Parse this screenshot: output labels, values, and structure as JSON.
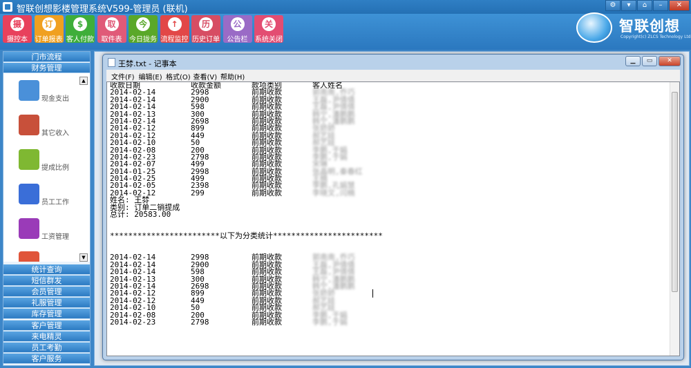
{
  "app": {
    "title": "智联创想影楼管理系统V599-管理员 (联机)",
    "logo_main": "智联创想",
    "logo_sub": "Copyright(c) ZLCS Technology Ltd"
  },
  "toolbar": [
    {
      "label": "摄控本",
      "color": "#e8415c",
      "glyph": "摄"
    },
    {
      "label": "订单报表",
      "color": "#f0a020",
      "glyph": "订"
    },
    {
      "label": "客人付款",
      "color": "#3fae3a",
      "glyph": "$"
    },
    {
      "label": "取件表",
      "color": "#e05a78",
      "glyph": "取"
    },
    {
      "label": "今日拢务",
      "color": "#5aa829",
      "glyph": "今"
    },
    {
      "label": "流程监控",
      "color": "#e24747",
      "glyph": "↑"
    },
    {
      "label": "历史订单",
      "color": "#d74d63",
      "glyph": "历"
    },
    {
      "label": "公告栏",
      "color": "#9a6bc6",
      "glyph": "公"
    },
    {
      "label": "系统关闭",
      "color": "#e34d72",
      "glyph": "关"
    }
  ],
  "sidebar": {
    "top_items": [
      "门市流程",
      "财务管理"
    ],
    "finance_items": [
      {
        "label": "现金支出",
        "color": "#4a90d9",
        "icon": "cash-out-icon"
      },
      {
        "label": "其它收入",
        "color": "#c8503a",
        "icon": "other-income-icon"
      },
      {
        "label": "提成比例",
        "color": "#7fb832",
        "icon": "commission-icon"
      },
      {
        "label": "员工工作",
        "color": "#3a6ed8",
        "icon": "staff-work-icon"
      },
      {
        "label": "工资管理",
        "color": "#9a3bb8",
        "icon": "salary-icon"
      }
    ],
    "bottom_items": [
      "统计查询",
      "短信群发",
      "会员管理",
      "礼服管理",
      "库存管理",
      "客户管理",
      "来电精灵",
      "员工考勤",
      "客户服务"
    ]
  },
  "notepad": {
    "title": "王棼.txt - 记事本",
    "menu": [
      "文件(F)",
      "编辑(E)",
      "格式(O)",
      "查看(V)",
      "帮助(H)"
    ],
    "headers": [
      "收款日期",
      "收款金额",
      "款项类别",
      "客人姓名"
    ],
    "rows": [
      [
        "2014-02-14",
        "2998",
        "前期收款",
        "郭南南,乔巧"
      ],
      [
        "2014-02-14",
        "2900",
        "前期收款",
        "王磊,尹倩倩"
      ],
      [
        "2014-02-14",
        "598",
        "前期收款",
        "王磊,尹倩倩"
      ],
      [
        "2014-02-13",
        "300",
        "前期收款",
        "韩宁,潘鹏鹏"
      ],
      [
        "2014-02-14",
        "2698",
        "前期收款",
        "韩宁,潘鹏鹏"
      ],
      [
        "2014-02-12",
        "899",
        "前期收款",
        "张娇娇"
      ],
      [
        "2014-02-12",
        "449",
        "前期收款",
        "郝艺娃"
      ],
      [
        "2014-02-10",
        "50",
        "前期收款",
        "郝艺娃"
      ],
      [
        "2014-02-08",
        "200",
        "前期收款",
        "李鹏,于娟"
      ],
      [
        "2014-02-23",
        "2798",
        "前期收款",
        "李鹏,于娟"
      ],
      [
        "2014-02-07",
        "499",
        "前期收款",
        "宋琳"
      ],
      [
        "2014-01-25",
        "2998",
        "前期收款",
        "张晶明,秦春红"
      ],
      [
        "2014-02-25",
        "499",
        "前期收款",
        "王楠"
      ],
      [
        "2014-02-05",
        "2398",
        "前期收款",
        "李鹏,孔娟慧"
      ],
      [
        "2014-02-12",
        "299",
        "前期收款",
        "李晓文,闫楠"
      ]
    ],
    "summary": [
      "姓名: 王棼",
      "类别: 订单二销提成",
      "总计: 20583.00"
    ],
    "separator": "************************以下为分类统计************************",
    "rows2": [
      [
        "2014-02-14",
        "2998",
        "前期收款",
        "郭南南,乔巧"
      ],
      [
        "2014-02-14",
        "2900",
        "前期收款",
        "王磊,尹倩倩"
      ],
      [
        "2014-02-14",
        "598",
        "前期收款",
        "王磊,尹倩倩"
      ],
      [
        "2014-02-13",
        "300",
        "前期收款",
        "韩宁,潘鹏鹏"
      ],
      [
        "2014-02-14",
        "2698",
        "前期收款",
        "韩宁,潘鹏鹏"
      ],
      [
        "2014-02-12",
        "899",
        "前期收款",
        "张娇娇"
      ],
      [
        "2014-02-12",
        "449",
        "前期收款",
        "郝艺娃"
      ],
      [
        "2014-02-10",
        "50",
        "前期收款",
        "郝艺娃"
      ],
      [
        "2014-02-08",
        "200",
        "前期收款",
        "李鹏,于娟"
      ],
      [
        "2014-02-23",
        "2798",
        "前期收款",
        "李鹏,于娟"
      ]
    ]
  }
}
